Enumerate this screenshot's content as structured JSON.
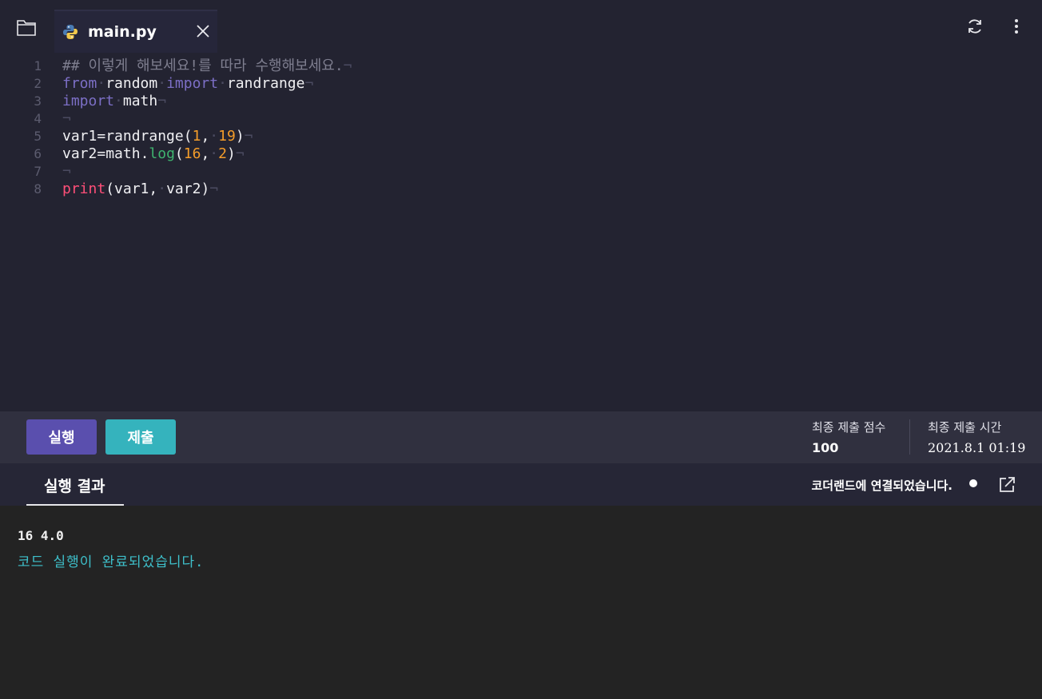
{
  "tab": {
    "filename": "main.py"
  },
  "editor": {
    "lines": [
      {
        "num": "1"
      },
      {
        "num": "2"
      },
      {
        "num": "3"
      },
      {
        "num": "4"
      },
      {
        "num": "5"
      },
      {
        "num": "6"
      },
      {
        "num": "7"
      },
      {
        "num": "8"
      }
    ],
    "tokens": {
      "l1_comment": "## 이렇게 해보세요!를 따라 수행해보세요.",
      "from": "from",
      "random": "random",
      "import": "import",
      "randrange": "randrange",
      "math": "math",
      "var1": "var1",
      "var2": "var2",
      "eq": "=",
      "paren_open": "(",
      "paren_close": ")",
      "comma": ",",
      "dot": ".",
      "one": "1",
      "nineteen": "19",
      "log": "log",
      "sixteen": "16",
      "two": "2",
      "print": "print",
      "eol": "¬",
      "ws": "·"
    }
  },
  "toolbar": {
    "run_label": "실행",
    "submit_label": "제출",
    "score_label": "최종 제출 점수",
    "score_value": "100",
    "time_label": "최종 제출 시간",
    "time_value": "2021.8.1 01:19"
  },
  "result": {
    "tab_label": "실행 결과",
    "connection_status": "코더랜드에 연결되었습니다.",
    "output_line": "16 4.0",
    "status_line": "코드 실행이 완료되었습니다."
  },
  "icons": {
    "folder": "folder-icon",
    "python": "python-icon",
    "close": "close-icon",
    "refresh": "refresh-icon",
    "more": "more-vertical-icon",
    "status_dot": "status-dot-icon",
    "external": "external-link-icon"
  },
  "colors": {
    "run_button": "#5a4fae",
    "submit_button": "#35b3bd",
    "keyword": "#7c6fc6",
    "function": "#ff4f78",
    "number": "#f49d2a",
    "method": "#3fb46f",
    "status_text": "#3ec0cb"
  }
}
